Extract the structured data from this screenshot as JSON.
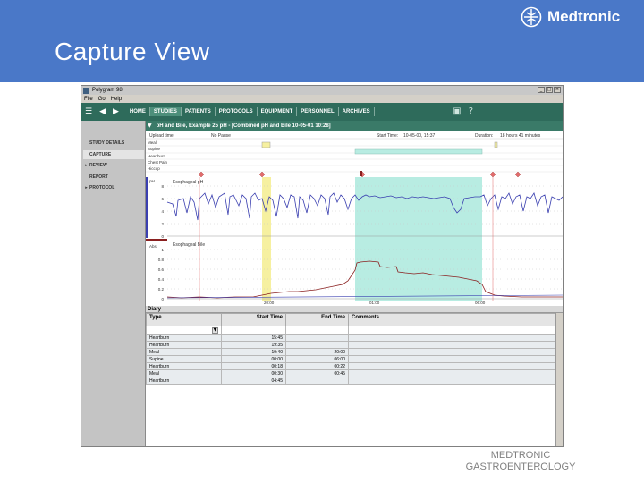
{
  "slide": {
    "title": "Capture View",
    "brand": "Medtronic",
    "footer_line1": "MEDTRONIC",
    "footer_line2": "GASTROENTEROLOGY"
  },
  "window": {
    "title": "Polygram 98",
    "buttons": [
      "_",
      "□",
      "×"
    ]
  },
  "menu": [
    "File",
    "Go",
    "Help"
  ],
  "nav": {
    "tabs": [
      "HOME",
      "STUDIES",
      "PATIENTS",
      "PROTOCOLS",
      "EQUIPMENT",
      "PERSONNEL",
      "ARCHIVES"
    ],
    "active_tab": "STUDIES"
  },
  "study": {
    "title": "pH and Bile, Example 25 pH - [Combined pH and Bile 10-05-01 10:28]"
  },
  "sidebar": {
    "items": [
      {
        "label": "STUDY DETAILS",
        "caret": ""
      },
      {
        "label": "CAPTURE",
        "caret": ""
      },
      {
        "label": "REVIEW",
        "caret": "▸"
      },
      {
        "label": "REPORT",
        "caret": ""
      },
      {
        "label": "PROTOCOL",
        "caret": "▸"
      }
    ],
    "active": "CAPTURE"
  },
  "chart_info": {
    "upload_label": "Upload time",
    "upload_value": "No Pause",
    "start_label": "Start Time:",
    "start_value": "10-05-00, 15:37",
    "duration_label": "Duration:",
    "duration_value": "18 hours 41 minutes",
    "event_labels": [
      "Meal",
      "Supine",
      "Heartburn",
      "Chest Pain",
      "Hiccup"
    ],
    "ph_channel": "Esophageal pH",
    "ph_unit": "pH",
    "ph_ticks": [
      "8",
      "6",
      "4",
      "2",
      "0"
    ],
    "bile_channel": "Esophageal Bile",
    "bile_unit": "Abs",
    "bile_ticks": [
      "1",
      "0.8",
      "0.6",
      "0.4",
      "0.2",
      "0"
    ],
    "time_ticks": [
      "20:00",
      "01:00",
      "06:00"
    ]
  },
  "diary": {
    "title": "Diary",
    "columns": [
      "Type",
      "Start Time",
      "End Time",
      "Comments"
    ],
    "rows": [
      {
        "type": "Heartburn",
        "start": "15:45",
        "end": "",
        "comments": ""
      },
      {
        "type": "Heartburn",
        "start": "19:35",
        "end": "",
        "comments": ""
      },
      {
        "type": "Meal",
        "start": "19:40",
        "end": "20:00",
        "comments": ""
      },
      {
        "type": "Supine",
        "start": "00:00",
        "end": "06:00",
        "comments": ""
      },
      {
        "type": "Heartburn",
        "start": "00:18",
        "end": "00:22",
        "comments": ""
      },
      {
        "type": "Meal",
        "start": "00:30",
        "end": "00:45",
        "comments": ""
      },
      {
        "type": "Heartburn",
        "start": "04:45",
        "end": "",
        "comments": ""
      }
    ]
  },
  "colors": {
    "header_blue": "#4a78c8",
    "toolbar_green": "#2e6b5b",
    "ph_trace": "#3a3fb0",
    "bile_trace": "#8a2020",
    "supine_band": "#b8ece2",
    "meal_band": "#f6f0a0",
    "marker_red": "#d05050"
  }
}
